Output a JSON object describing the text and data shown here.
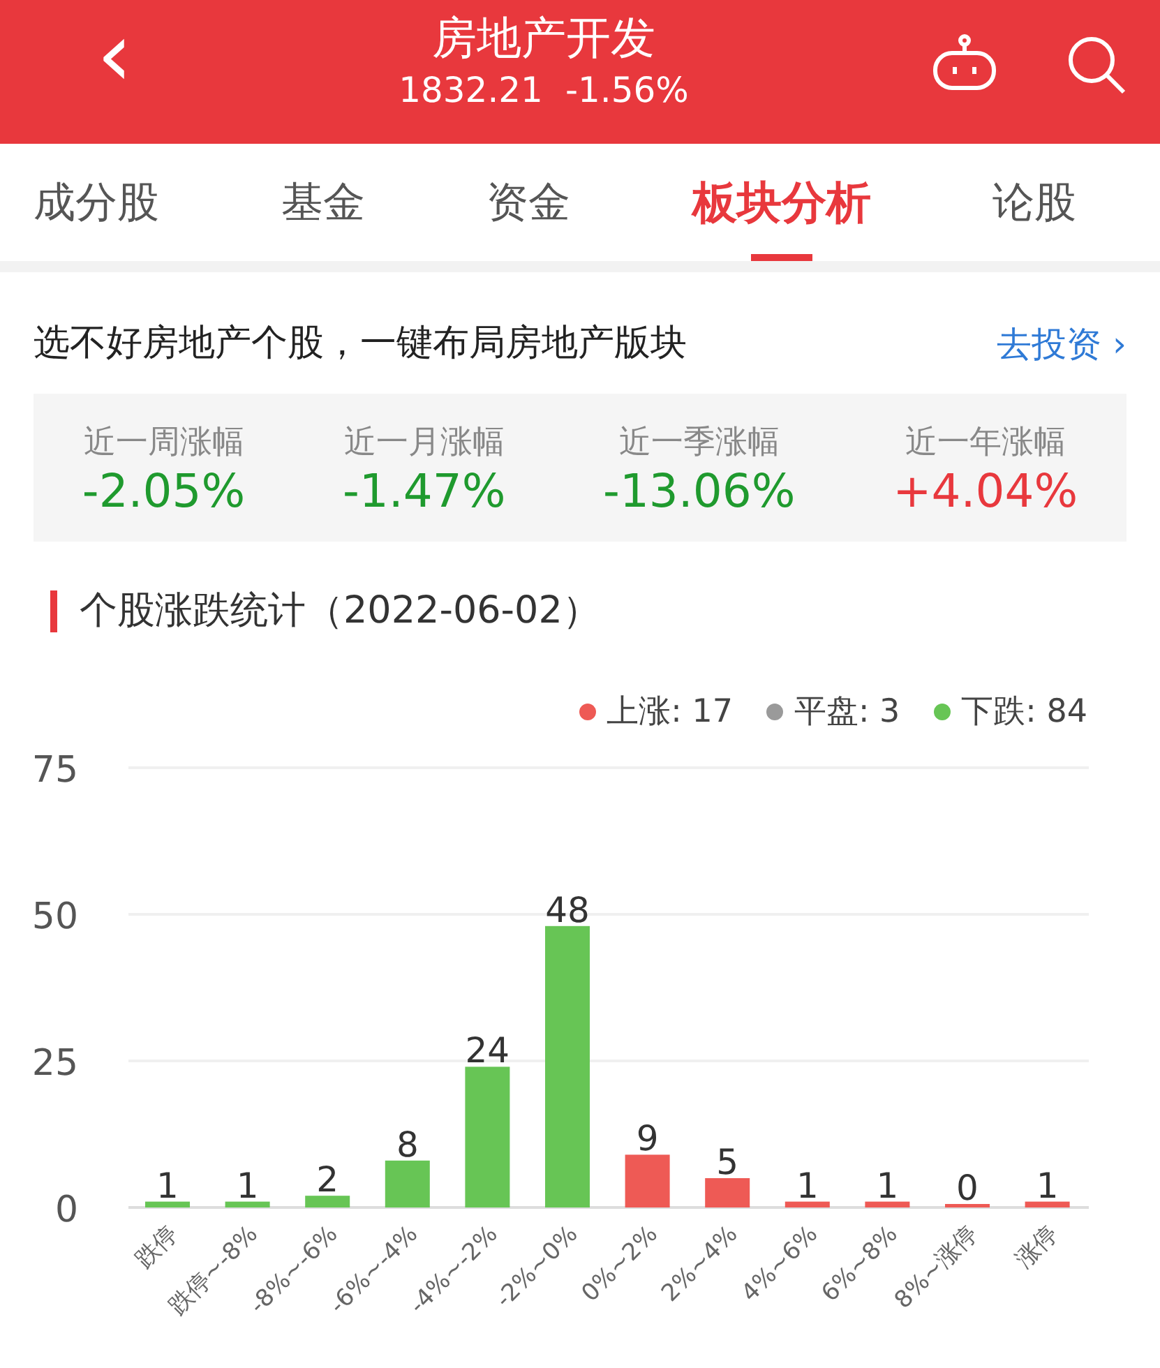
{
  "header": {
    "back": "‹",
    "title": "房地产开发",
    "price": "1832.21",
    "change": "-1.56%"
  },
  "tabs": [
    {
      "label": "成分股",
      "selected": false
    },
    {
      "label": "基金",
      "selected": false
    },
    {
      "label": "资金",
      "selected": false
    },
    {
      "label": "板块分析",
      "selected": true
    },
    {
      "label": "论股",
      "selected": false
    }
  ],
  "promo": {
    "text": "选不好房地产个股，一键布局房地产版块",
    "link": "去投资",
    "arrow": "›"
  },
  "stats": [
    {
      "label": "近一周涨幅",
      "value": "-2.05%",
      "color": "#1f9a2e"
    },
    {
      "label": "近一月涨幅",
      "value": "-1.47%",
      "color": "#1f9a2e"
    },
    {
      "label": "近一季涨幅",
      "value": "-13.06%",
      "color": "#1f9a2e"
    },
    {
      "label": "近一年涨幅",
      "value": "+4.04%",
      "color": "#e8383d"
    }
  ],
  "section_title": "个股涨跌统计（2022-06-02）",
  "legend": [
    {
      "label": "上涨: 17",
      "color": "#ee5a55"
    },
    {
      "label": "平盘: 3",
      "color": "#9a9a9a"
    },
    {
      "label": "下跌: 84",
      "color": "#67c555"
    }
  ],
  "chart": {
    "chart_data": {
      "type": "bar",
      "categories": [
        "跌停",
        "跌停~-8%",
        "-8%~-6%",
        "-6%~-4%",
        "-4%~-2%",
        "-2%~0%",
        "0%~2%",
        "2%~4%",
        "4%~6%",
        "6%~8%",
        "8%~涨停",
        "涨停"
      ],
      "series": [
        {
          "color": "#67c555",
          "values": [
            1,
            1,
            2,
            8,
            24,
            48,
            null,
            null,
            null,
            null,
            null,
            null
          ]
        },
        {
          "color": "#ee5a55",
          "values": [
            null,
            null,
            null,
            null,
            null,
            null,
            9,
            5,
            1,
            1,
            0,
            1
          ]
        }
      ],
      "ylim": [
        0,
        75
      ],
      "yticks": [
        0,
        25,
        50,
        75
      ],
      "data_labels": true
    }
  }
}
